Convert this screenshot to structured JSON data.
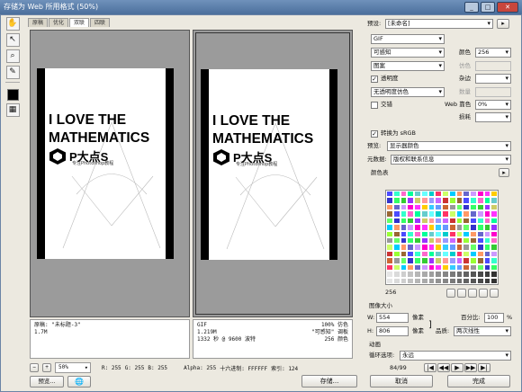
{
  "window": {
    "title": "存储为 Web 所用格式 (50%)",
    "buttons": {
      "minimize": "_",
      "maximize": "□",
      "close": "✕"
    }
  },
  "tabs": [
    "原稿",
    "优化",
    "双联",
    "四联"
  ],
  "active_tab": "双联",
  "document": {
    "line1": "I LOVE THE",
    "line2": "MATHEMATICS",
    "brand": "P大点S",
    "brand_sub": "专注Photoshop教程"
  },
  "status_left": {
    "name": "原稿: \"未标题-3\"",
    "size": "1.7M"
  },
  "status_right": {
    "format": "GIF",
    "dither": "100% 仿色",
    "size": "1.219M",
    "palette": "\"可感知\" 调板",
    "time": "1332 秒 @ 9600 波特",
    "colors": "256 颜色"
  },
  "bottom": {
    "zoom": "50%",
    "r": "R: 255",
    "g": "G: 255",
    "b": "B: 255",
    "alpha": "Alpha: 255",
    "hex": "十六进制: FFFFFF",
    "index": "索引: 124"
  },
  "settings": {
    "preset_label": "预设:",
    "preset": "[未命名]",
    "format": "GIF",
    "reduction": "可感知",
    "colors_label": "颜色",
    "colors": "256",
    "dither_algo": "图案",
    "dither_label": "仿色",
    "transparency": "透明度",
    "matte_label": "杂边",
    "transparency_dither": "无透明度仿色",
    "amount_label": "数量",
    "interlaced": "交错",
    "web_snap_label": "Web 靠色",
    "web_snap": "0%",
    "lossy_label": "损耗",
    "convert_srgb": "转换为 sRGB",
    "preview_label": "预览:",
    "preview": "显示器颜色",
    "metadata_label": "元数据:",
    "metadata": "版权和联系信息",
    "color_table_label": "颜色表",
    "color_count": "256",
    "image_size_label": "图像大小",
    "w_label": "W:",
    "w": "554",
    "px1": "像素",
    "h_label": "H:",
    "h": "806",
    "px2": "像素",
    "percent_label": "百分比:",
    "percent": "100",
    "percent_unit": "%",
    "quality_label": "品质:",
    "quality": "两次线性",
    "anim_label": "动画",
    "loop_label": "循环选项:",
    "loop": "永远",
    "frames": "84/99"
  },
  "buttons": {
    "preview": "预览...",
    "save": "存储...",
    "cancel": "取消",
    "done": "完成"
  },
  "palette_colors": [
    "#4b4bff",
    "#33cc33",
    "#ff33ff",
    "#66ffff",
    "#cc66ff",
    "#999999",
    "#ff9966",
    "#33ffcc",
    "#9933ff",
    "#ffcc00",
    "#00cccc",
    "#cc3333",
    "#66ff66",
    "#6666cc",
    "#ff66cc",
    "#cccc66",
    "#33ccff",
    "#ff3366",
    "#99ff33",
    "#3333cc",
    "#cc99ff",
    "#00ff99",
    "#ff9999",
    "#6699ff",
    "#ccff66",
    "#996633",
    "#33ff66",
    "#ff00cc",
    "#66cccc",
    "#9999ff",
    "#cc6633",
    "#00ccff"
  ]
}
